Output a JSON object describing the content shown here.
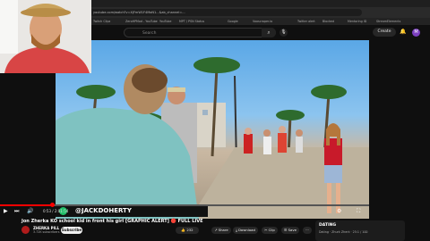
{
  "browser": {
    "url": "youtube.com/watch?v=XjFmW1F4MaN1...&ab_channel=...",
    "bookmarks": [
      "Twitch Clipz",
      "ZeroHPMod - YouTube",
      "YouTube",
      "YouTube - YouTube",
      "MPT / PSN Status",
      "Google",
      "Vooscraper.io",
      "Twitter alert",
      "Blocked",
      "Subscribe",
      "Mentoring ID",
      "StreamElements"
    ]
  },
  "header": {
    "search_placeholder": "Search",
    "create_label": "Create",
    "avatar_letter": "M"
  },
  "video": {
    "caption_tag": "@JACKDOHERTY",
    "progress": 0.14,
    "time": "0:53 / 2:01:54"
  },
  "info": {
    "title": "Jon Zherka KO school kid in front his girl [GRAPHIC ALERT] 🔴 FULL LIVE",
    "channel": "ZHERKA PILL",
    "subscribers": "3.72K subscribers",
    "subscribe_label": "Subscribe",
    "likes": "232",
    "share_label": "Share",
    "download_label": "Download",
    "clip_label": "Clip",
    "save_label": "Save"
  },
  "recommendation": {
    "title": "DATING",
    "meta": "Dating · Zhurk Zherk · 25:1 / 100"
  },
  "icons": {
    "play": "play-icon",
    "next": "next-icon",
    "volume": "volume-icon",
    "settings": "gear-icon",
    "fullscreen": "fullscreen-icon"
  },
  "colors": {
    "accent": "#ff0000",
    "background": "#0f0f0f",
    "subscribe_bg": "#f1f1f1"
  }
}
